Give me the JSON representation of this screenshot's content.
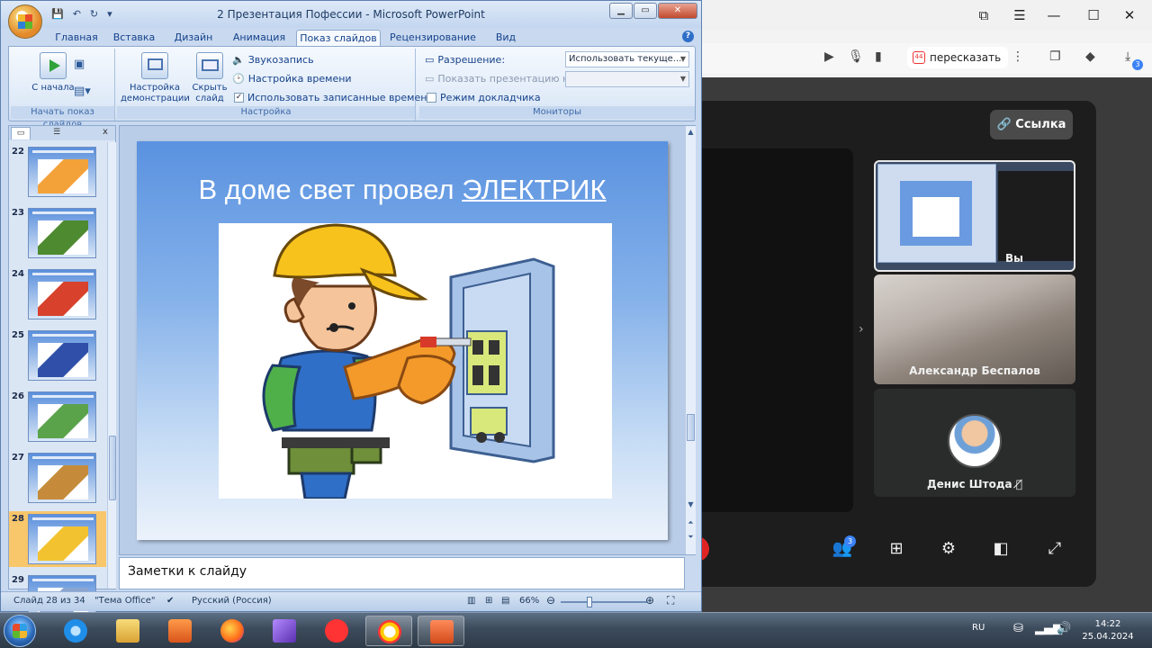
{
  "ppt": {
    "title": "2 Презентация Пофессии - Microsoft PowerPoint",
    "tabs": [
      "Главная",
      "Вставка",
      "Дизайн",
      "Анимация",
      "Показ слайдов",
      "Рецензирование",
      "Вид"
    ],
    "active_tab": "Показ слайдов",
    "ribbon": {
      "group_start": {
        "label": "Начать показ слайдов",
        "from_start": "С начала"
      },
      "group_setup": {
        "label": "Настройка",
        "setup_show": "Настройка демонстрации",
        "hide_slide": "Скрыть слайд",
        "record_narration": "Звукозапись",
        "rehearse_timings": "Настройка времени",
        "use_timings": "Использовать записанные времена",
        "use_timings_checked": true
      },
      "group_monitors": {
        "label": "Мониторы",
        "resolution_label": "Разрешение:",
        "resolution_value": "Использовать текуще...",
        "show_on_label": "Показать презентацию на:",
        "show_on_value": "",
        "presenter_view": "Режим докладчика",
        "presenter_view_checked": false
      }
    },
    "thumbnails": [
      {
        "num": "22",
        "active": false,
        "pic": "#f3a23a"
      },
      {
        "num": "23",
        "active": false,
        "pic": "#4e8a2f"
      },
      {
        "num": "24",
        "active": false,
        "pic": "#d8412b"
      },
      {
        "num": "25",
        "active": false,
        "pic": "#2f4fa8"
      },
      {
        "num": "26",
        "active": false,
        "pic": "#5aa34a"
      },
      {
        "num": "27",
        "active": false,
        "pic": "#c58b3a"
      },
      {
        "num": "28",
        "active": true,
        "pic": "#f2c230"
      },
      {
        "num": "29",
        "active": false,
        "pic": "#8aa6d0"
      }
    ],
    "slide": {
      "title_prefix": "В доме свет провел ",
      "title_link": "ЭЛЕКТРИК"
    },
    "notes_placeholder": "Заметки к слайду",
    "status": {
      "slide_pos": "Слайд 28 из 34",
      "theme": "\"Тема Office\"",
      "language": "Русский (Россия)",
      "zoom": "66%",
      "zoom_level": 0.66
    }
  },
  "browser": {
    "retell_label": "пересказать",
    "retell_badge": "44",
    "downloads_badge": "3"
  },
  "conference": {
    "link_button": "Ссылка",
    "participants_badge": "3",
    "tiles": [
      {
        "name": "Вы"
      },
      {
        "name": "Александр Беспалов"
      },
      {
        "name": "Денис Штода"
      }
    ]
  },
  "taskbar": {
    "lang": "RU",
    "time": "14:22",
    "date": "25.04.2024"
  },
  "colors": {
    "ribbon_text": "#15428b",
    "active_thumb": "#f8c66b",
    "conference_bg": "#1d1d1d",
    "accent_blue": "#3b82f6"
  }
}
